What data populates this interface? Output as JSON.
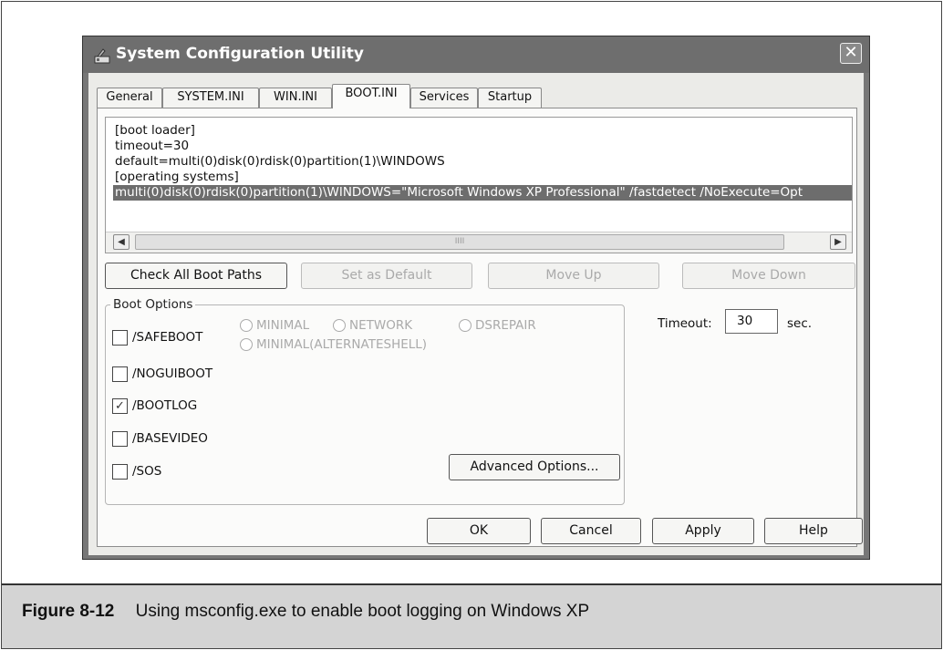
{
  "window": {
    "title": "System Configuration Utility",
    "close_glyph": "✕"
  },
  "tabs": [
    {
      "label": "General",
      "active": false
    },
    {
      "label": "SYSTEM.INI",
      "active": false
    },
    {
      "label": "WIN.INI",
      "active": false
    },
    {
      "label": "BOOT.INI",
      "active": true
    },
    {
      "label": "Services",
      "active": false
    },
    {
      "label": "Startup",
      "active": false
    }
  ],
  "boot_ini": {
    "lines": [
      "[boot loader]",
      "timeout=30",
      "default=multi(0)disk(0)rdisk(0)partition(1)\\WINDOWS",
      "[operating systems]",
      "multi(0)disk(0)rdisk(0)partition(1)\\WINDOWS=\"Microsoft Windows XP Professional\" /fastdetect /NoExecute=Opt"
    ],
    "selected_index": 4
  },
  "scrollbar": {
    "left_arrow": "◀",
    "right_arrow": "▶",
    "grip": "IIII"
  },
  "path_buttons": {
    "check_all": "Check All Boot Paths",
    "set_default": "Set as Default",
    "move_up": "Move Up",
    "move_down": "Move Down"
  },
  "boot_options": {
    "legend": "Boot Options",
    "safeboot": {
      "label": "/SAFEBOOT",
      "checked": false
    },
    "noguiboot": {
      "label": "/NOGUIBOOT",
      "checked": false
    },
    "bootlog": {
      "label": "/BOOTLOG",
      "checked": true
    },
    "basevideo": {
      "label": "/BASEVIDEO",
      "checked": false
    },
    "sos": {
      "label": "/SOS",
      "checked": false
    },
    "radios": {
      "minimal": "MINIMAL",
      "network": "NETWORK",
      "dsrepair": "DSREPAIR",
      "minimal_alt": "MINIMAL(ALTERNATESHELL)"
    },
    "check_glyph": "✓",
    "advanced": "Advanced Options..."
  },
  "timeout": {
    "label": "Timeout:",
    "value": "30",
    "unit": "sec."
  },
  "footer_buttons": {
    "ok": "OK",
    "cancel": "Cancel",
    "apply": "Apply",
    "help": "Help"
  },
  "caption": {
    "label": "Figure 8-12",
    "text": "Using msconfig.exe to enable boot logging on Windows XP"
  }
}
